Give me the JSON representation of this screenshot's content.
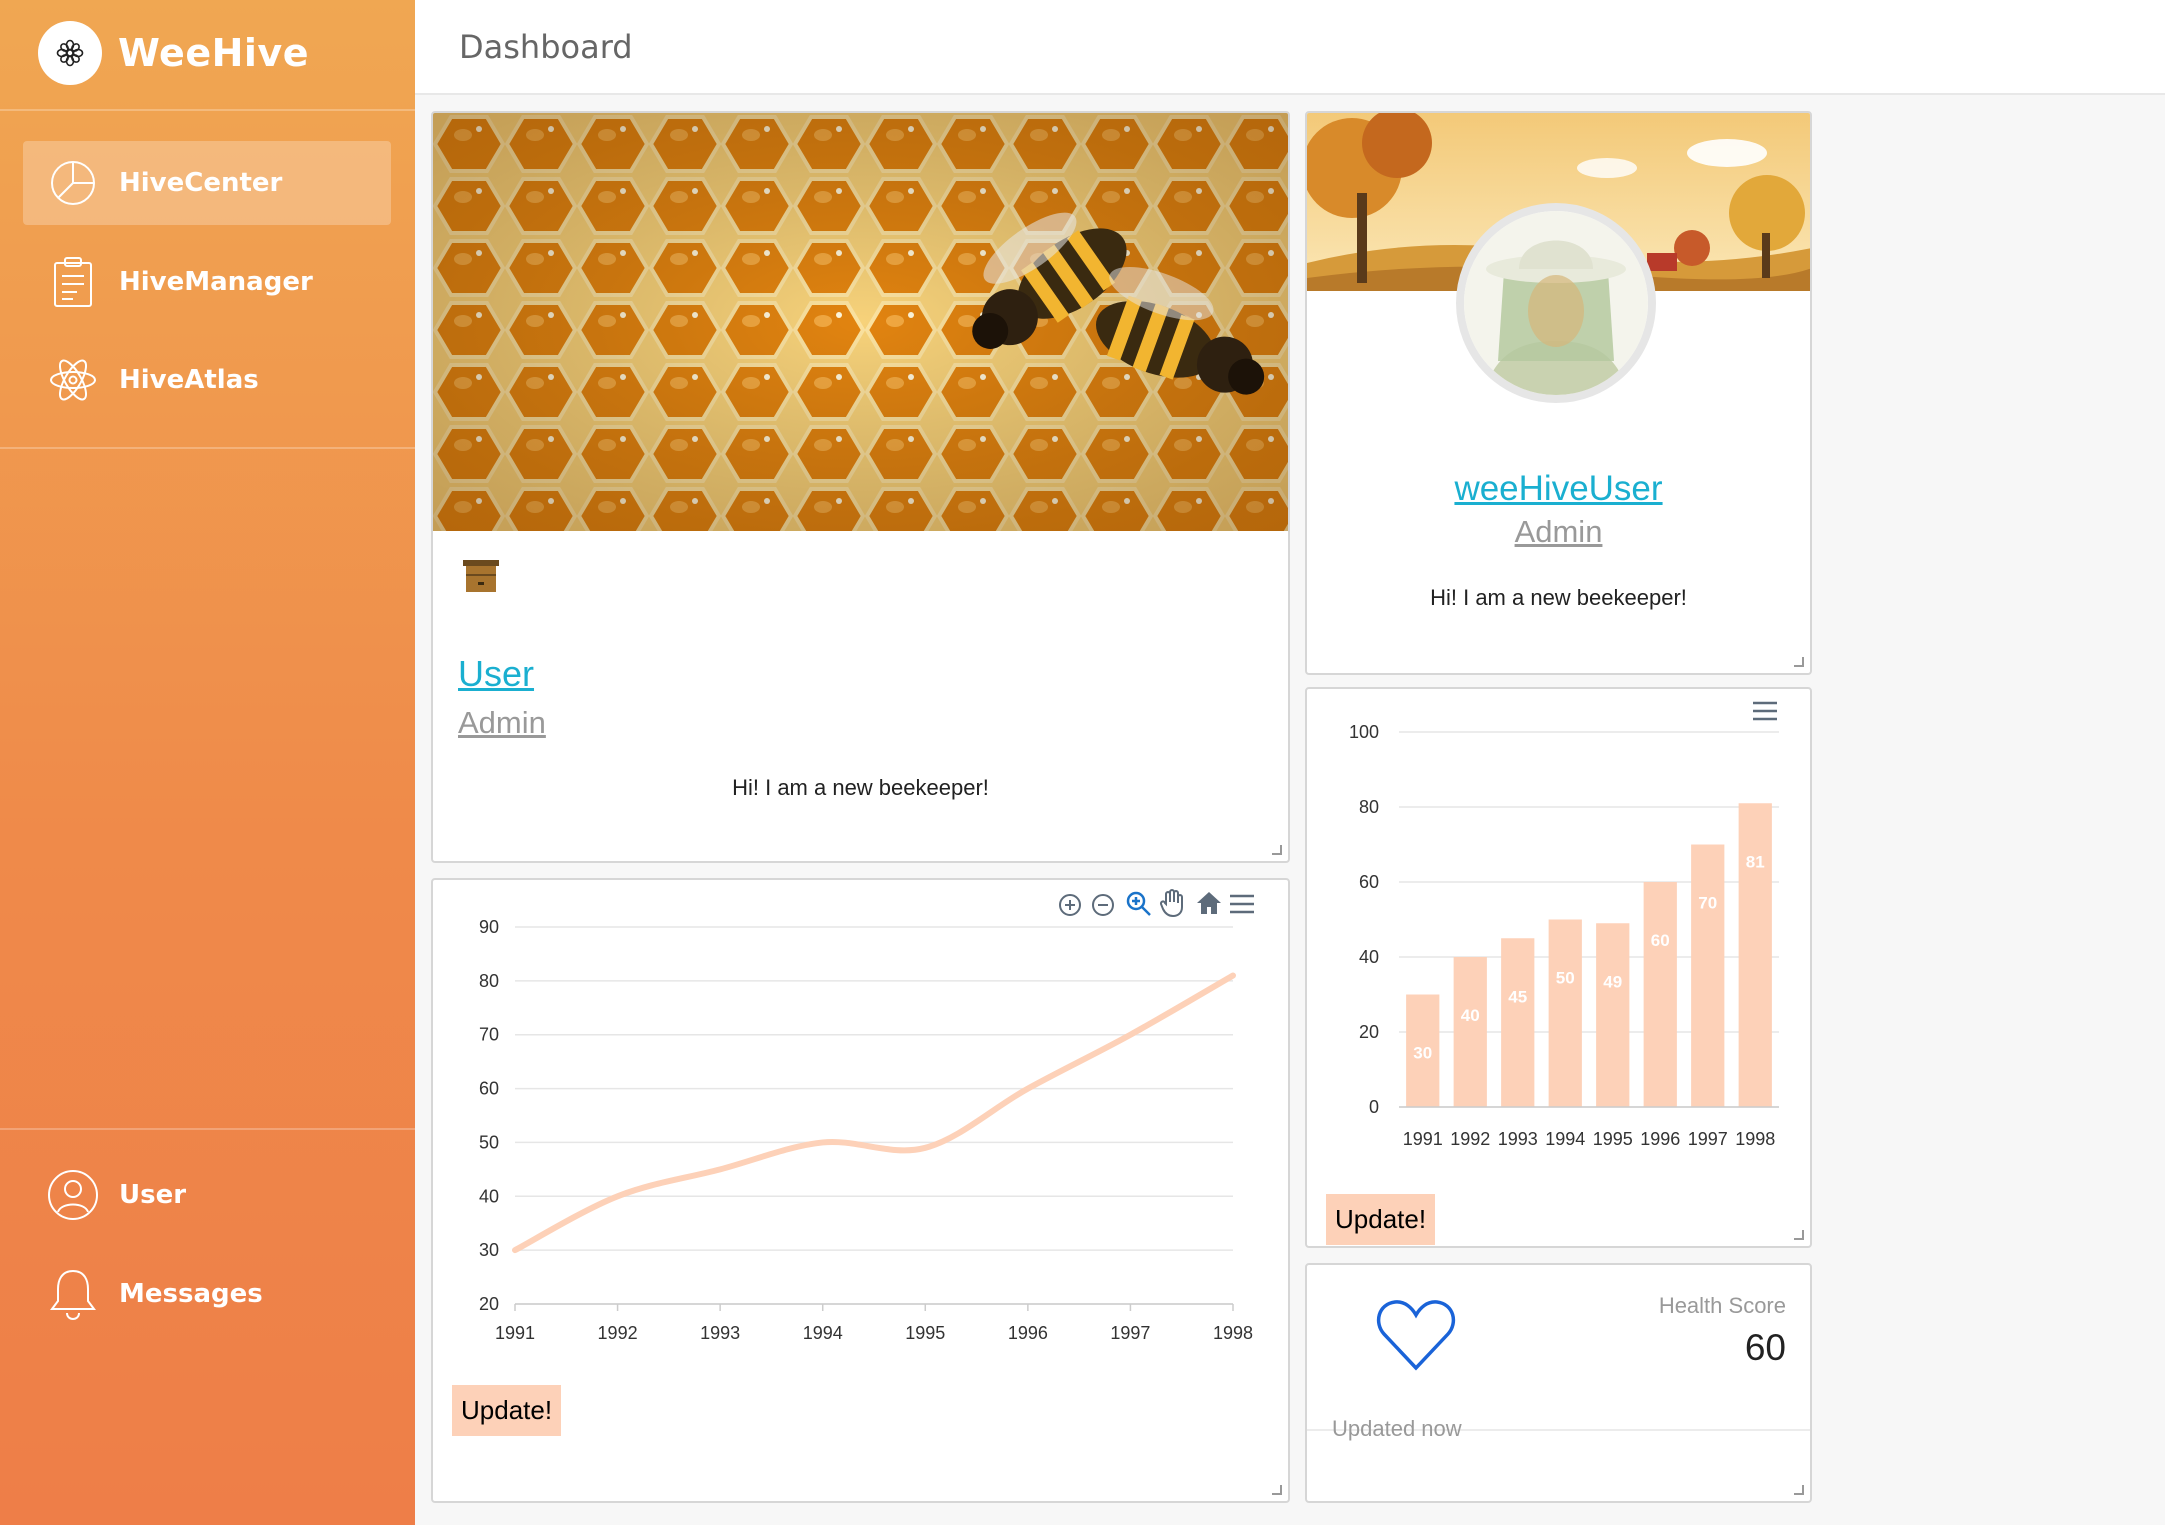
{
  "app": {
    "name": "WeeHive"
  },
  "sidebar": {
    "items": [
      {
        "label": "HiveCenter",
        "icon": "pie-chart-icon",
        "active": true
      },
      {
        "label": "HiveManager",
        "icon": "clipboard-icon",
        "active": false
      },
      {
        "label": "HiveAtlas",
        "icon": "atom-icon",
        "active": false
      }
    ],
    "bottom_items": [
      {
        "label": "User",
        "icon": "user-icon"
      },
      {
        "label": "Messages",
        "icon": "bell-icon"
      }
    ]
  },
  "header": {
    "title": "Dashboard"
  },
  "hive_card": {
    "name": "User",
    "role": "Admin",
    "bio": "Hi! I am a new beekeeper!"
  },
  "profile_card": {
    "name": "weeHiveUser",
    "role": "Admin",
    "bio": "Hi! I am a new beekeeper!"
  },
  "line_card": {
    "button": "Update!"
  },
  "bar_card": {
    "button": "Update!"
  },
  "health_card": {
    "label": "Health Score",
    "value": "60",
    "status": "Updated now"
  },
  "colors": {
    "accent": "#ef8a4a",
    "series": "#fdd1b8",
    "link": "#1aafd0"
  },
  "chart_data": [
    {
      "type": "line",
      "x": [
        1991,
        1992,
        1993,
        1994,
        1995,
        1996,
        1997,
        1998
      ],
      "series": [
        {
          "values": [
            30,
            40,
            45,
            50,
            49,
            60,
            70,
            81
          ]
        }
      ],
      "ylim": [
        20,
        90
      ],
      "yticks": [
        20,
        30,
        40,
        50,
        60,
        70,
        80,
        90
      ],
      "grid": true,
      "toolbar": [
        "zoom-in-icon",
        "zoom-out-icon",
        "zoom-selection-icon",
        "pan-hand-icon",
        "home-reset-icon",
        "menu-icon"
      ]
    },
    {
      "type": "bar",
      "categories": [
        "1991",
        "1992",
        "1993",
        "1994",
        "1995",
        "1996",
        "1997",
        "1998"
      ],
      "series": [
        {
          "values": [
            30,
            40,
            45,
            50,
            49,
            60,
            70,
            81
          ]
        }
      ],
      "ylim": [
        0,
        100
      ],
      "yticks": [
        0,
        20,
        40,
        60,
        80,
        100
      ],
      "grid": true,
      "data_labels": true,
      "toolbar": [
        "menu-icon"
      ]
    }
  ]
}
